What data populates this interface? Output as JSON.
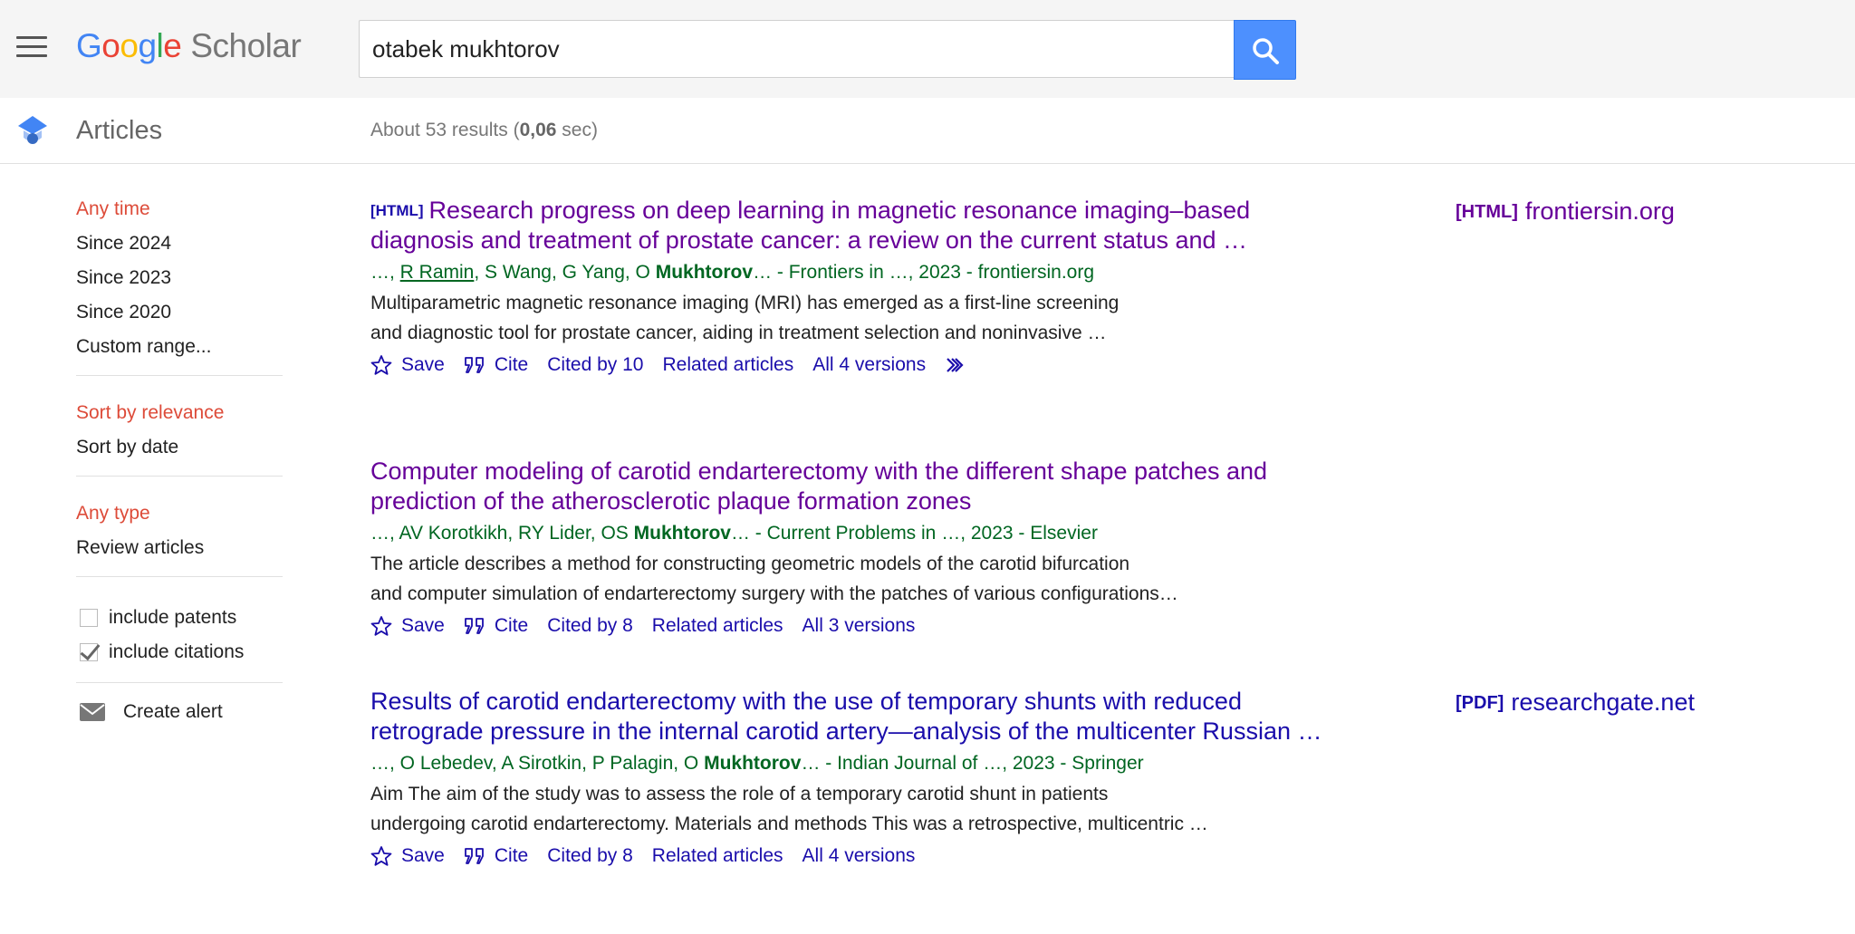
{
  "header": {
    "logo_letters": [
      "G",
      "o",
      "o",
      "g",
      "l",
      "e"
    ],
    "logo_product": "Scholar",
    "search_value": "otabek mukhtorov"
  },
  "subheader": {
    "section_title": "Articles",
    "stats_prefix": "About 53 results (",
    "stats_time": "0,06",
    "stats_suffix": " sec)"
  },
  "sidebar": {
    "time_filters": [
      "Any time",
      "Since 2024",
      "Since 2023",
      "Since 2020",
      "Custom range..."
    ],
    "sort_options": [
      "Sort by relevance",
      "Sort by date"
    ],
    "type_filters": [
      "Any type",
      "Review articles"
    ],
    "include_patents": "include patents",
    "include_citations": "include citations",
    "create_alert": "Create alert"
  },
  "results": [
    {
      "tag": "[HTML]",
      "title": "Research progress on deep learning in magnetic resonance imaging–based diagnosis and treatment of prostate cancer: a review on the current status and …",
      "meta_prefix": "…, ",
      "meta_author_link": "R Ramin",
      "meta_mid": ", S Wang, G Yang, O ",
      "meta_bold": "Mukhtorov",
      "meta_suffix": "… - Frontiers in …, 2023 - frontiersin.org",
      "snippet_1": "Multiparametric magnetic resonance imaging (MRI) has emerged as a first-line screening",
      "snippet_2": "and diagnostic tool for prostate cancer, aiding in treatment selection and noninvasive …",
      "save": "Save",
      "cite": "Cite",
      "cited_by": "Cited by 10",
      "related": "Related articles",
      "versions": "All 4 versions",
      "side_tag": "[HTML]",
      "side_domain": "frontiersin.org"
    },
    {
      "title": "Computer modeling of carotid endarterectomy with the different shape patches and prediction of the atherosclerotic plaque formation zones",
      "meta_prefix": "…, AV Korotkikh, RY Lider, OS ",
      "meta_bold": "Mukhtorov",
      "meta_suffix": "… - Current Problems in …, 2023 - Elsevier",
      "snippet_1": "The article describes a method for constructing geometric models of the carotid bifurcation",
      "snippet_2": "and computer simulation of endarterectomy surgery with the patches of various configurations…",
      "save": "Save",
      "cite": "Cite",
      "cited_by": "Cited by 8",
      "related": "Related articles",
      "versions": "All 3 versions"
    },
    {
      "title": "Results of carotid endarterectomy with the use of temporary shunts with reduced retrograde pressure in the internal carotid artery—analysis of the multicenter Russian …",
      "meta_prefix": "…, O Lebedev, A Sirotkin, P Palagin, O ",
      "meta_bold": "Mukhtorov",
      "meta_suffix": "… - Indian Journal of …, 2023 - Springer",
      "snippet_1": "Aim The aim of the study was to assess the role of a temporary carotid shunt in patients",
      "snippet_2": "undergoing carotid endarterectomy. Materials and methods This was a retrospective, multicentric …",
      "save": "Save",
      "cite": "Cite",
      "cited_by": "Cited by 8",
      "related": "Related articles",
      "versions": "All 4 versions",
      "side_tag": "[PDF]",
      "side_domain": "researchgate.net"
    }
  ],
  "colors": {
    "link": "#1a0dab",
    "visited": "#660099",
    "meta_green": "#006621",
    "active_filter": "#dd4b39",
    "search_button": "#4d90fe"
  }
}
